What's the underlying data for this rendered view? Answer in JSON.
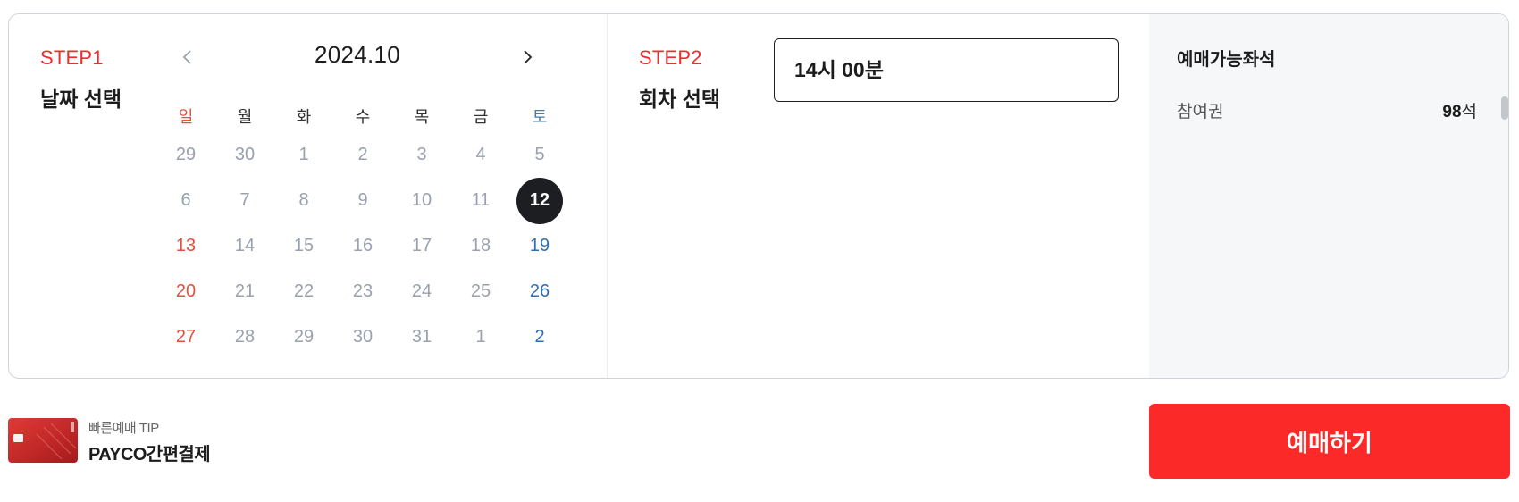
{
  "step1": {
    "label": "STEP1",
    "title": "날짜 선택"
  },
  "calendar": {
    "month": "2024.10",
    "weekdays": [
      "일",
      "월",
      "화",
      "수",
      "목",
      "금",
      "토"
    ],
    "weeks": [
      [
        "29",
        "30",
        "1",
        "2",
        "3",
        "4",
        "5"
      ],
      [
        "6",
        "7",
        "8",
        "9",
        "10",
        "11",
        "12"
      ],
      [
        "13",
        "14",
        "15",
        "16",
        "17",
        "18",
        "19"
      ],
      [
        "20",
        "21",
        "22",
        "23",
        "24",
        "25",
        "26"
      ],
      [
        "27",
        "28",
        "29",
        "30",
        "31",
        "1",
        "2"
      ]
    ],
    "selected": "12"
  },
  "step2": {
    "label": "STEP2",
    "title": "회차 선택",
    "time_slot": "14시 00분"
  },
  "seats": {
    "title": "예매가능좌석",
    "items": [
      {
        "name": "참여권",
        "count": "98",
        "unit": "석"
      }
    ]
  },
  "tip": {
    "label": "빠른예매 TIP",
    "text": "PAYCO간편결제"
  },
  "book_button": {
    "label": "예매하기"
  },
  "colors": {
    "accent": "#fb2a28",
    "sunday": "#e2513c",
    "saturday": "#2f6fb1",
    "selected_day": "#1d1e22"
  },
  "icons": {
    "prev": "chevron-left-icon",
    "next": "chevron-right-icon",
    "card": "credit-card-icon"
  }
}
